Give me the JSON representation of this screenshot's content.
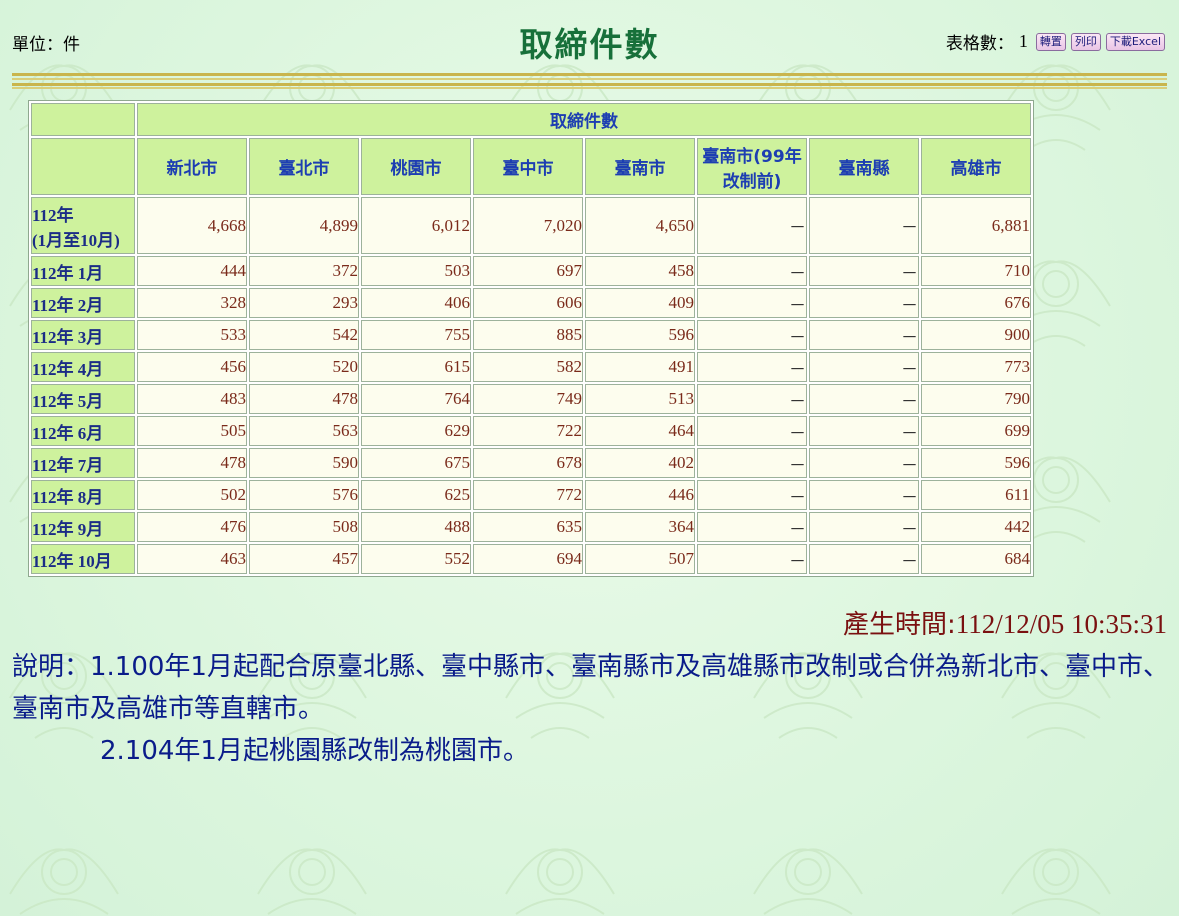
{
  "header": {
    "unit_label": "單位：件",
    "title": "取締件數",
    "table_count_label": "表格數：",
    "table_count_value": "1",
    "buttons": {
      "transpose": "轉置",
      "print": "列印",
      "download_excel": "下載Excel"
    }
  },
  "table": {
    "group_header": "取締件數",
    "columns": [
      "新北市",
      "臺北市",
      "桃園市",
      "臺中市",
      "臺南市",
      "臺南市(99年改制前)",
      "臺南縣",
      "高雄市"
    ],
    "columns_display": [
      [
        "新北市"
      ],
      [
        "臺北市"
      ],
      [
        "桃園市"
      ],
      [
        "臺中市"
      ],
      [
        "臺南市"
      ],
      [
        "臺南市(99年",
        "改制前)"
      ],
      [
        "臺南縣"
      ],
      [
        "高雄市"
      ]
    ],
    "rows": [
      {
        "label_lines": [
          "112年",
          "(1月至10月)"
        ],
        "values": [
          "4,668",
          "4,899",
          "6,012",
          "7,020",
          "4,650",
          "－",
          "－",
          "6,881"
        ]
      },
      {
        "label_lines": [
          "112年 1月"
        ],
        "values": [
          "444",
          "372",
          "503",
          "697",
          "458",
          "－",
          "－",
          "710"
        ]
      },
      {
        "label_lines": [
          "112年 2月"
        ],
        "values": [
          "328",
          "293",
          "406",
          "606",
          "409",
          "－",
          "－",
          "676"
        ]
      },
      {
        "label_lines": [
          "112年 3月"
        ],
        "values": [
          "533",
          "542",
          "755",
          "885",
          "596",
          "－",
          "－",
          "900"
        ]
      },
      {
        "label_lines": [
          "112年 4月"
        ],
        "values": [
          "456",
          "520",
          "615",
          "582",
          "491",
          "－",
          "－",
          "773"
        ]
      },
      {
        "label_lines": [
          "112年 5月"
        ],
        "values": [
          "483",
          "478",
          "764",
          "749",
          "513",
          "－",
          "－",
          "790"
        ]
      },
      {
        "label_lines": [
          "112年 6月"
        ],
        "values": [
          "505",
          "563",
          "629",
          "722",
          "464",
          "－",
          "－",
          "699"
        ]
      },
      {
        "label_lines": [
          "112年 7月"
        ],
        "values": [
          "478",
          "590",
          "675",
          "678",
          "402",
          "－",
          "－",
          "596"
        ]
      },
      {
        "label_lines": [
          "112年 8月"
        ],
        "values": [
          "502",
          "576",
          "625",
          "772",
          "446",
          "－",
          "－",
          "611"
        ]
      },
      {
        "label_lines": [
          "112年 9月"
        ],
        "values": [
          "476",
          "508",
          "488",
          "635",
          "364",
          "－",
          "－",
          "442"
        ]
      },
      {
        "label_lines": [
          "112年 10月"
        ],
        "values": [
          "463",
          "457",
          "552",
          "694",
          "507",
          "－",
          "－",
          "684"
        ]
      }
    ]
  },
  "footer": {
    "generated_label": "產生時間:",
    "generated_value": "112/12/05 10:35:31",
    "note_line1": "說明：1.100年1月起配合原臺北縣、臺中縣市、臺南縣市及高雄縣市改制或合併為新北市、臺中市、臺南市及高雄市等直轄市。",
    "note_line2": "2.104年1月起桃園縣改制為桃園市。"
  },
  "colors": {
    "title": "#17703a",
    "header_bg": "#cef29d",
    "header_text": "#1d3eb2",
    "cell_bg": "#fdfdee",
    "cell_text": "#7a2a1a",
    "note_text": "#0a1c8a",
    "time_text": "#7a1010"
  }
}
